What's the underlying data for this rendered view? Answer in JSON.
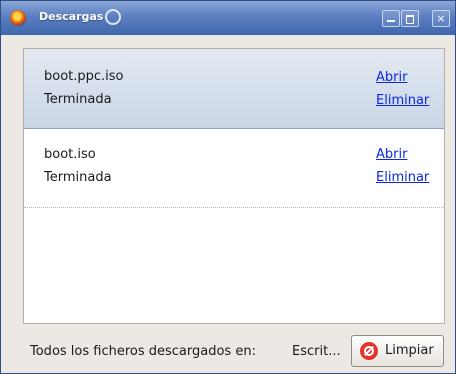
{
  "window": {
    "title": "Descargas",
    "controls": {
      "minimize": "",
      "maximize": "",
      "close": "×"
    }
  },
  "downloads": [
    {
      "name": "boot.ppc.iso",
      "status": "Terminada",
      "open_label": "Abrir",
      "remove_label": "Eliminar",
      "selected": true
    },
    {
      "name": "boot.iso",
      "status": "Terminada",
      "open_label": "Abrir",
      "remove_label": "Eliminar",
      "selected": false
    }
  ],
  "footer": {
    "label": "Todos los ficheros descargados en:",
    "directory": "Escrit...",
    "clear_label": "Limpiar"
  },
  "colors": {
    "titlebar": "#4e74b8",
    "selected_row": "#d4dfeb",
    "link": "#0b27e8",
    "clear_icon": "#e2342b"
  },
  "icons": {
    "app": "firefox-icon",
    "title_decoration": "swirl-icon",
    "clear": "stop-icon"
  }
}
